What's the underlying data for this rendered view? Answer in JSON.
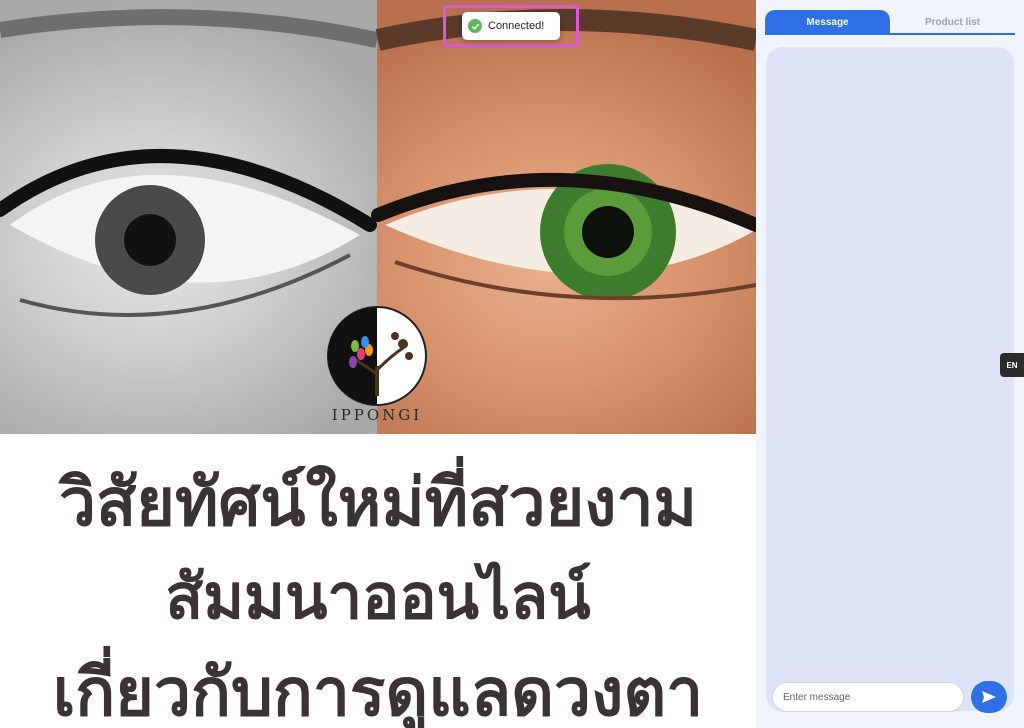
{
  "toast": {
    "text": "Connected!",
    "icon": "check-circle-icon",
    "color": "#5cb85c"
  },
  "banner": {
    "logo_text": "IPPONGI",
    "headline_lines": [
      "วิสัยทัศน์ใหม่ที่สวยงาม",
      "สัมมนาออนไลน์",
      "เกี่ยวกับการดูแลดวงตา"
    ]
  },
  "chat": {
    "tabs": [
      {
        "label": "Message",
        "active": true
      },
      {
        "label": "Product list",
        "active": false
      }
    ],
    "input_placeholder": "Enter message",
    "send_icon": "send-icon",
    "accent": "#2f6fe8"
  },
  "language_toggle": {
    "label": "EN"
  }
}
